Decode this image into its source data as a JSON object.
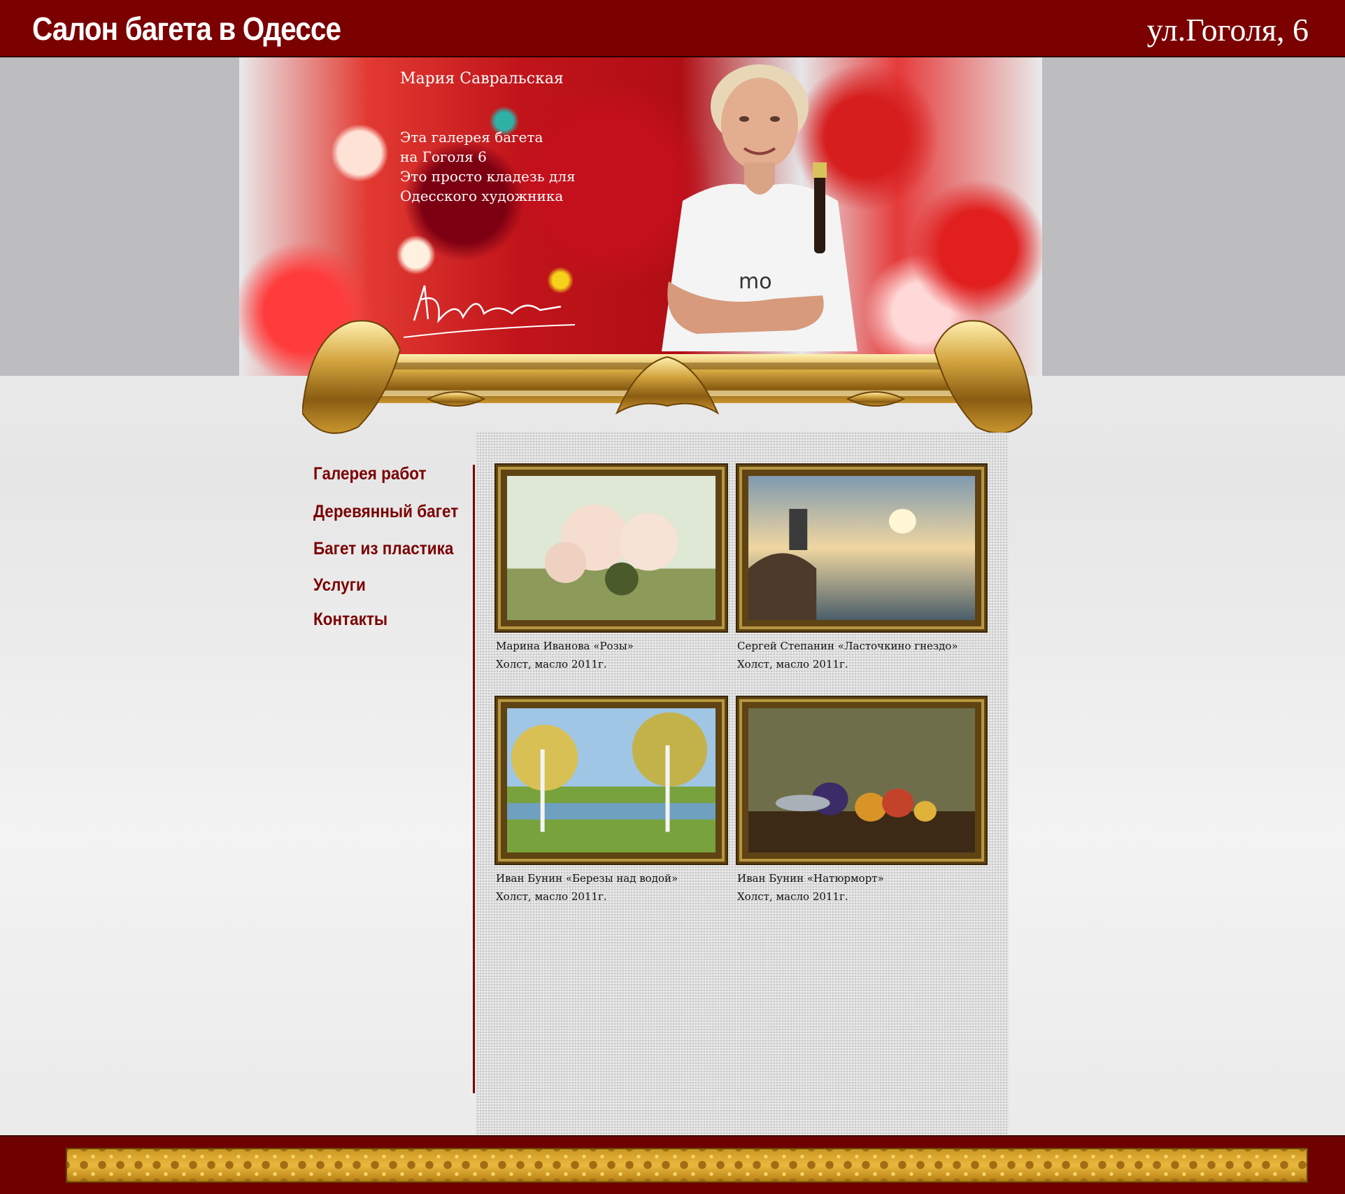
{
  "header": {
    "title": "Салон багета в Одессе",
    "address": "ул.Гоголя, 6"
  },
  "hero": {
    "name": "Мария Савральская",
    "text_lines": [
      "Эта галерея багета",
      "на Гоголя 6",
      "Это просто кладезь для",
      "Одесского художника"
    ]
  },
  "nav": {
    "items": [
      {
        "label": "Галерея работ"
      },
      {
        "label": "Деревянный багет"
      },
      {
        "label": "Багет из пластика"
      },
      {
        "label": "Услуги"
      },
      {
        "label": "Контакты"
      }
    ]
  },
  "gallery": {
    "items": [
      {
        "artist_title": "Марина Иванова «Розы»",
        "details": "Холст, масло 2011г."
      },
      {
        "artist_title": "Сергей Степанин «Ласточкино гнездо»",
        "details": "Холст, масло 2011г."
      },
      {
        "artist_title": "Иван Бунин «Березы над водой»",
        "details": "Холст, масло 2011г."
      },
      {
        "artist_title": "Иван Бунин «Натюрморт»",
        "details": "Холст, масло 2011г."
      }
    ]
  },
  "colors": {
    "brand": "#7b0000",
    "footer": "#6e0000",
    "gold": "#c9941f"
  }
}
